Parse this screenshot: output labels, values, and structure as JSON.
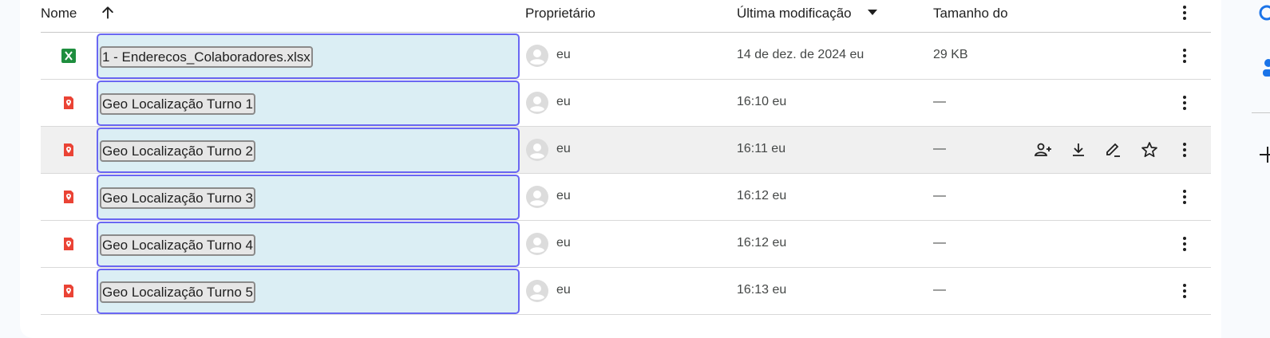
{
  "header": {
    "name": "Nome",
    "owner": "Proprietário",
    "modified": "Última modificação",
    "size": "Tamanho do"
  },
  "rows": [
    {
      "name": "1 - Enderecos_Colaboradores.xlsx",
      "type": "xlsx",
      "owner": "eu",
      "modified": "14 de dez. de 2024 eu",
      "size": "29 KB"
    },
    {
      "name": "Geo Localização Turno 1",
      "type": "map",
      "owner": "eu",
      "modified": "16:10 eu",
      "size": "—"
    },
    {
      "name": "Geo Localização Turno 2",
      "type": "map",
      "owner": "eu",
      "modified": "16:11 eu",
      "size": "—"
    },
    {
      "name": "Geo Localização Turno 3",
      "type": "map",
      "owner": "eu",
      "modified": "16:12 eu",
      "size": "—"
    },
    {
      "name": "Geo Localização Turno 4",
      "type": "map",
      "owner": "eu",
      "modified": "16:12 eu",
      "size": "—"
    },
    {
      "name": "Geo Localização Turno 5",
      "type": "map",
      "owner": "eu",
      "modified": "16:13 eu",
      "size": "—"
    }
  ],
  "hovered_row": 2,
  "icons": {
    "sort": "arrow-up-icon",
    "sort_direction": "caret-down-icon",
    "more": "more-vert-icon",
    "xlsx": "sheets-icon",
    "map": "my-maps-icon",
    "owner": "account-circle-icon",
    "share": "person-add-icon",
    "download": "download-icon",
    "rename": "edit-icon",
    "star": "star-outline-icon"
  },
  "colors": {
    "sheets": "#1e8e3e",
    "maps": "#ea4335",
    "selection_border": "#6a67f2",
    "selection_fill": "#dbeef4"
  }
}
